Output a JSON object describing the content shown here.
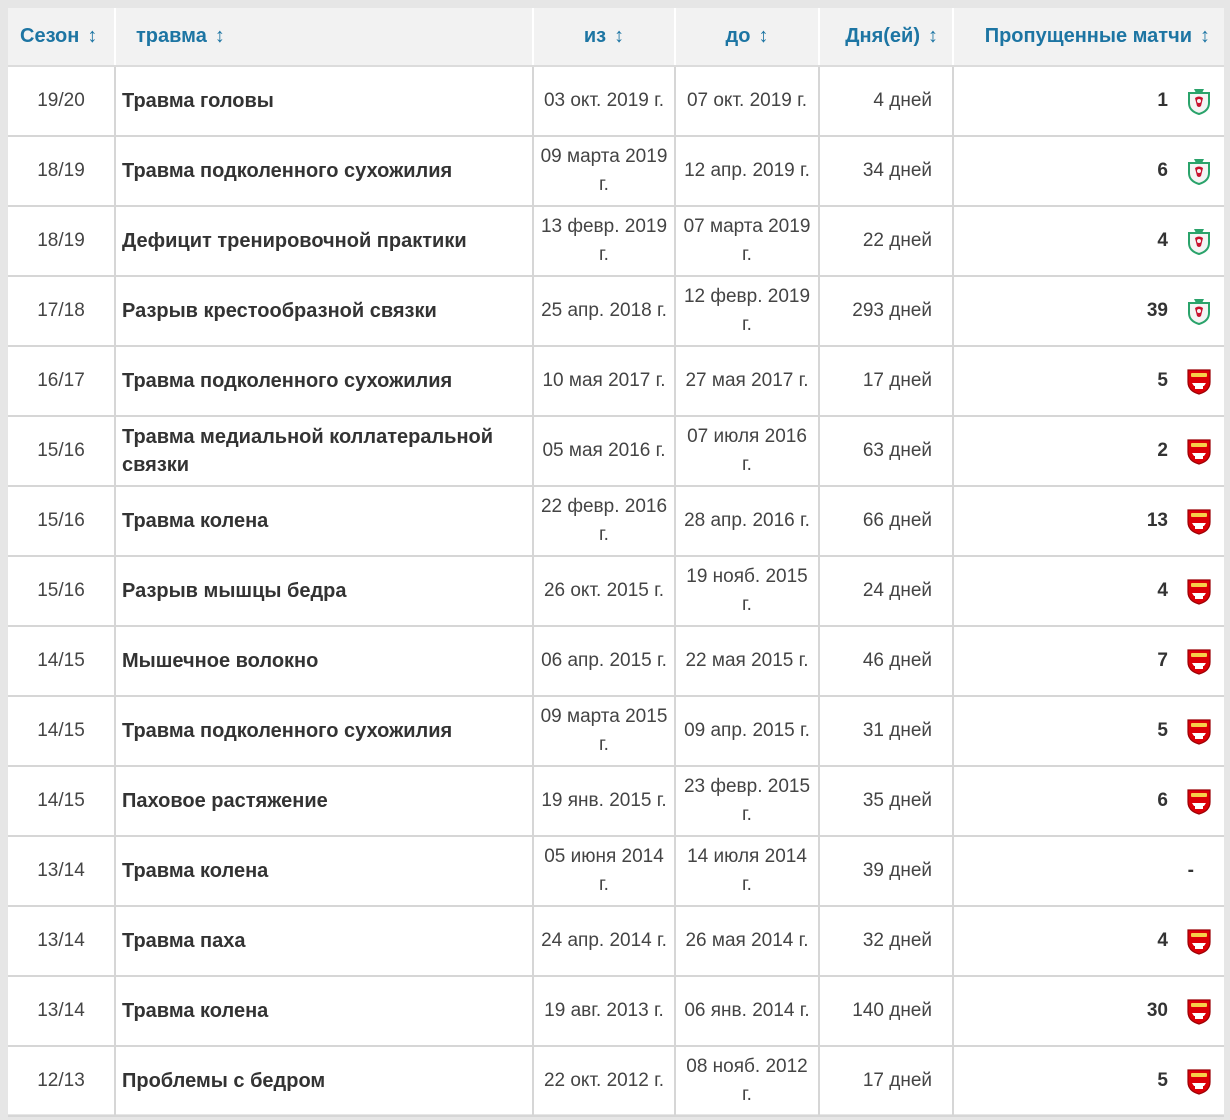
{
  "columns": {
    "season": "Сезон",
    "injury": "травма",
    "from": "из",
    "to": "до",
    "days": "Дня(ей)",
    "games_missed": "Пропущенные матчи"
  },
  "sort_icon": "↕",
  "clubs": {
    "liverpool-icon": {
      "color": "#c8102e",
      "accent": "#2aa36b"
    },
    "arsenal-icon": {
      "color": "#db0007",
      "accent": "#f6d14a"
    }
  },
  "rows": [
    {
      "season": "19/20",
      "injury": "Травма головы",
      "from": "03 окт. 2019 г.",
      "to": "07 окт. 2019 г.",
      "days": "4 дней",
      "games": "1",
      "club": "liverpool-icon"
    },
    {
      "season": "18/19",
      "injury": "Травма подколенного сухожилия",
      "from": "09 марта 2019 г.",
      "to": "12 апр. 2019 г.",
      "days": "34 дней",
      "games": "6",
      "club": "liverpool-icon"
    },
    {
      "season": "18/19",
      "injury": "Дефицит тренировочной практики",
      "from": "13 февр. 2019 г.",
      "to": "07 марта 2019 г.",
      "days": "22 дней",
      "games": "4",
      "club": "liverpool-icon"
    },
    {
      "season": "17/18",
      "injury": "Разрыв крестообразной связки",
      "from": "25 апр. 2018 г.",
      "to": "12 февр. 2019 г.",
      "days": "293 дней",
      "games": "39",
      "club": "liverpool-icon"
    },
    {
      "season": "16/17",
      "injury": "Травма подколенного сухожилия",
      "from": "10 мая 2017 г.",
      "to": "27 мая 2017 г.",
      "days": "17 дней",
      "games": "5",
      "club": "arsenal-icon"
    },
    {
      "season": "15/16",
      "injury": "Травма медиальной коллатеральной связки",
      "from": "05 мая 2016 г.",
      "to": "07 июля 2016 г.",
      "days": "63 дней",
      "games": "2",
      "club": "arsenal-icon"
    },
    {
      "season": "15/16",
      "injury": "Травма колена",
      "from": "22 февр. 2016 г.",
      "to": "28 апр. 2016 г.",
      "days": "66 дней",
      "games": "13",
      "club": "arsenal-icon"
    },
    {
      "season": "15/16",
      "injury": "Разрыв мышцы бедра",
      "from": "26 окт. 2015 г.",
      "to": "19 нояб. 2015 г.",
      "days": "24 дней",
      "games": "4",
      "club": "arsenal-icon"
    },
    {
      "season": "14/15",
      "injury": "Мышечное волокно",
      "from": "06 апр. 2015 г.",
      "to": "22 мая 2015 г.",
      "days": "46 дней",
      "games": "7",
      "club": "arsenal-icon"
    },
    {
      "season": "14/15",
      "injury": "Травма подколенного сухожилия",
      "from": "09 марта 2015 г.",
      "to": "09 апр. 2015 г.",
      "days": "31 дней",
      "games": "5",
      "club": "arsenal-icon"
    },
    {
      "season": "14/15",
      "injury": "Паховое растяжение",
      "from": "19 янв. 2015 г.",
      "to": "23 февр. 2015 г.",
      "days": "35 дней",
      "games": "6",
      "club": "arsenal-icon"
    },
    {
      "season": "13/14",
      "injury": "Травма колена",
      "from": "05 июня 2014 г.",
      "to": "14 июля 2014 г.",
      "days": "39 дней",
      "games": "-",
      "club": ""
    },
    {
      "season": "13/14",
      "injury": "Травма паха",
      "from": "24 апр. 2014 г.",
      "to": "26 мая 2014 г.",
      "days": "32 дней",
      "games": "4",
      "club": "arsenal-icon"
    },
    {
      "season": "13/14",
      "injury": "Травма колена",
      "from": "19 авг. 2013 г.",
      "to": "06 янв. 2014 г.",
      "days": "140 дней",
      "games": "30",
      "club": "arsenal-icon"
    },
    {
      "season": "12/13",
      "injury": "Проблемы с бедром",
      "from": "22 окт. 2012 г.",
      "to": "08 нояб. 2012 г.",
      "days": "17 дней",
      "games": "5",
      "club": "arsenal-icon"
    }
  ]
}
